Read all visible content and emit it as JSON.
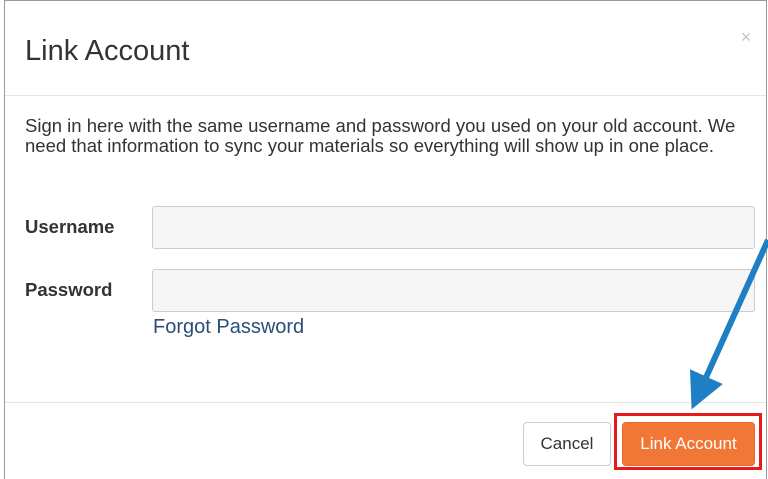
{
  "dialog": {
    "title": "Link Account",
    "close_glyph": "×",
    "intro_text": "Sign in here with the same username and password you used on your old account. We need that information to sync your materials so everything will show up in one place."
  },
  "form": {
    "username_label": "Username",
    "username_value": "",
    "password_label": "Password",
    "password_value": "",
    "forgot_password_link": "Forgot Password"
  },
  "footer": {
    "cancel_label": "Cancel",
    "link_account_label": "Link Account"
  },
  "annotation": {
    "highlight_color": "#e31b1b",
    "arrow_color": "#1f7fc4"
  },
  "colors": {
    "primary_button": "#f07735",
    "link": "#2a4f78"
  }
}
